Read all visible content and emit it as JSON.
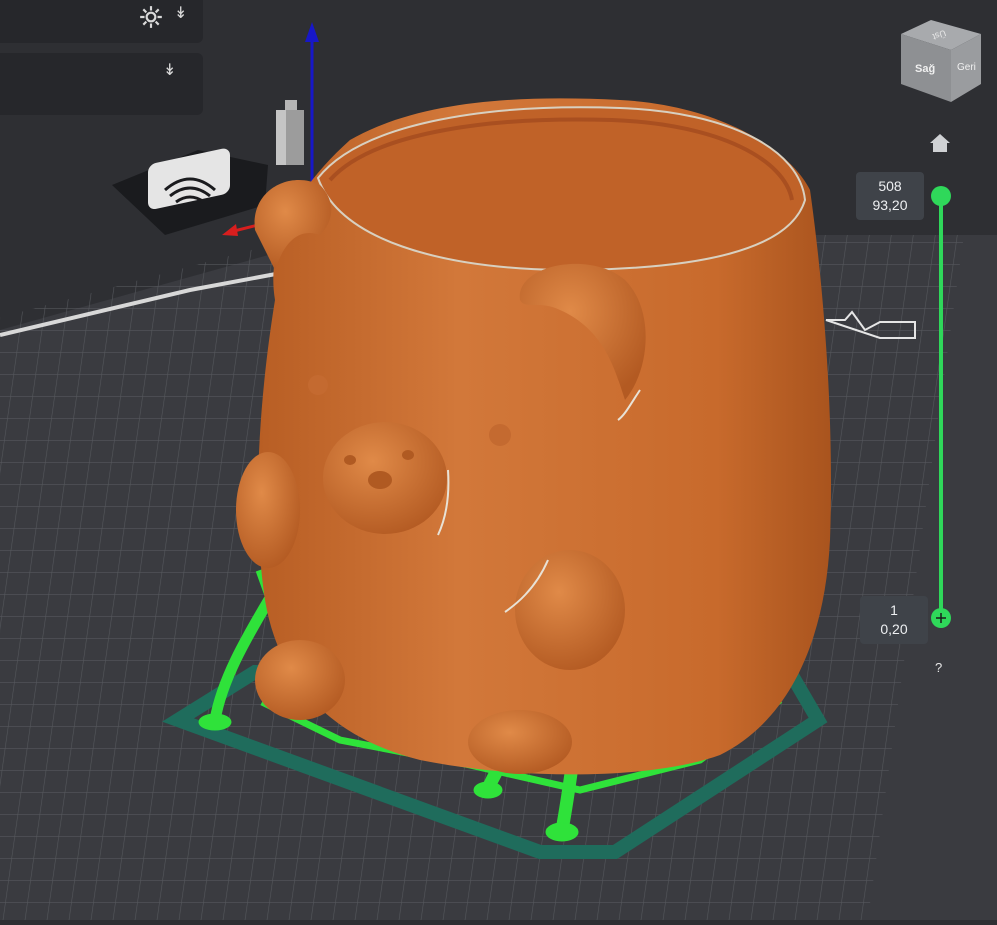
{
  "app": {
    "panels": [
      {
        "name": "settings-panel",
        "icons": [
          "gear-icon",
          "double-chevron-down-icon"
        ]
      },
      {
        "name": "options-panel",
        "icons": [
          "double-chevron-down-icon"
        ]
      }
    ]
  },
  "view_cube": {
    "faces": {
      "top": "Üst",
      "right_side": "Sağ",
      "back": "Geri"
    }
  },
  "layer_slider": {
    "top": {
      "layer": "508",
      "height": "93,20"
    },
    "bottom": {
      "layer": "1",
      "height": "0,20"
    },
    "help": "?",
    "fraction": 1.0
  },
  "colors": {
    "background": "#2e2f33",
    "bed_grid": "#4f5055",
    "model_orange": "#c96a2c",
    "support_green": "#2fe23a",
    "brim_teal": "#1f6c5c",
    "slider_green": "#2fd85a",
    "x_axis": "#d81e1e",
    "z_axis": "#1717c8"
  },
  "icons": [
    "gear-icon",
    "double-chevron-down-icon",
    "home-icon",
    "view-cube-icon",
    "fingerprint-logo-icon"
  ]
}
